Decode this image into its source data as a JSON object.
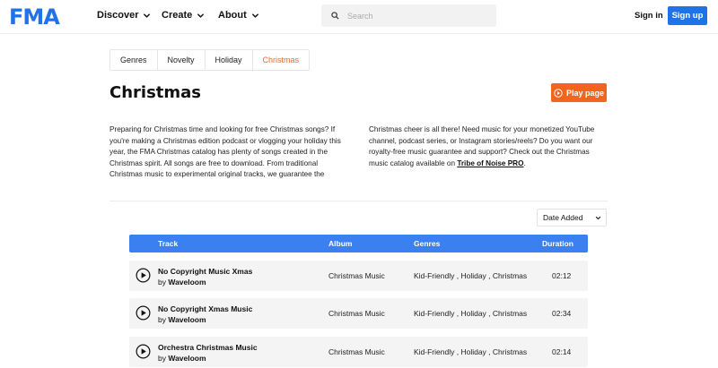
{
  "header": {
    "logo": "FMA",
    "nav": [
      "Discover",
      "Create",
      "About"
    ],
    "search_placeholder": "Search",
    "signin": "Sign in",
    "signup": "Sign up"
  },
  "tabs": [
    {
      "label": "Genres",
      "active": false
    },
    {
      "label": "Novelty",
      "active": false
    },
    {
      "label": "Holiday",
      "active": false
    },
    {
      "label": "Christmas",
      "active": true
    }
  ],
  "page": {
    "title": "Christmas",
    "play_label": "Play page",
    "desc_left": "Preparing for Christmas time and looking for free Christmas songs? If you're making a Christmas edition podcast or vlogging your holiday this year, the FMA Christmas catalog has plenty of songs created in the Christmas spirit. All songs are free to download. From traditional Christmas music to experimental original tracks, we guarantee the",
    "desc_right_prefix": "Christmas cheer is all there! Need music for your monetized YouTube channel, podcast series, or Instagram stories/reels? Do you want our royalty-free music guarantee and support? Check out the Christmas music catalog available on ",
    "desc_right_link": "Tribe of Noise PRO",
    "desc_right_suffix": "."
  },
  "sort": {
    "selected": "Date Added"
  },
  "table": {
    "headers": {
      "track": "Track",
      "album": "Album",
      "genres": "Genres",
      "duration": "Duration"
    },
    "rows": [
      {
        "title": "No Copyright Music Xmas",
        "by": "by",
        "artist": "Waveloom",
        "album": "Christmas Music",
        "genres": [
          "Kid-Friendly",
          "Holiday",
          "Christmas"
        ],
        "duration": "02:12"
      },
      {
        "title": "No Copyright Xmas Music",
        "by": "by",
        "artist": "Waveloom",
        "album": "Christmas Music",
        "genres": [
          "Kid-Friendly",
          "Holiday",
          "Christmas"
        ],
        "duration": "02:34"
      },
      {
        "title": "Orchestra Christmas Music",
        "by": "by",
        "artist": "Waveloom",
        "album": "Christmas Music",
        "genres": [
          "Kid-Friendly",
          "Holiday",
          "Christmas"
        ],
        "duration": "02:14"
      }
    ],
    "genre_separator": " , "
  },
  "colors": {
    "brand_blue": "#1e73e8",
    "accent_orange": "#f2651d",
    "table_header": "#3a80f0"
  }
}
